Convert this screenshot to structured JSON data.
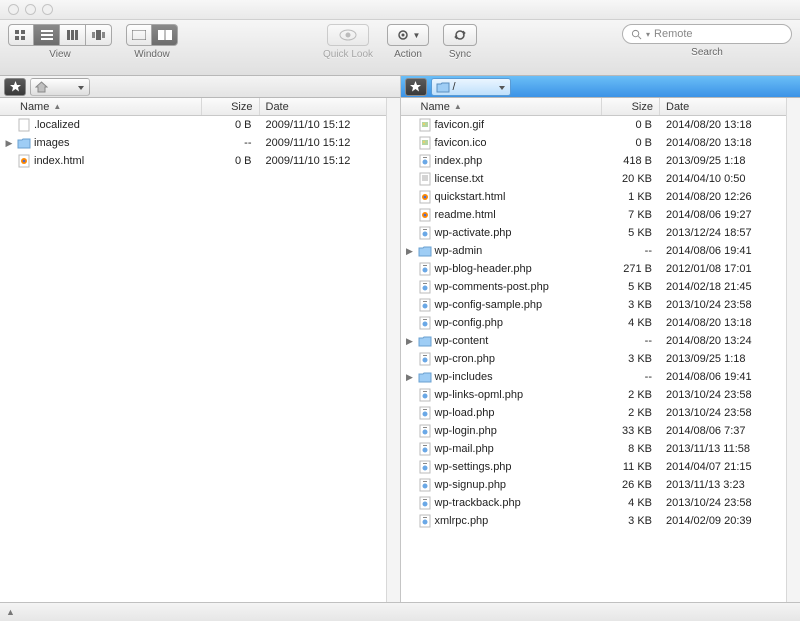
{
  "toolbar": {
    "view_label": "View",
    "window_label": "Window",
    "quicklook_label": "Quick Look",
    "action_label": "Action",
    "sync_label": "Sync",
    "search_label": "Search",
    "search_placeholder": "Remote"
  },
  "columns": {
    "name": "Name",
    "size": "Size",
    "date": "Date"
  },
  "left": {
    "path": "/",
    "files": [
      {
        "name": ".localized",
        "size": "0 B",
        "date": "2009/11/10 15:12",
        "type": "file"
      },
      {
        "name": "images",
        "size": "--",
        "date": "2009/11/10 15:12",
        "type": "folder",
        "expandable": true
      },
      {
        "name": "index.html",
        "size": "0 B",
        "date": "2009/11/10 15:12",
        "type": "html"
      }
    ]
  },
  "right": {
    "path": "/",
    "files": [
      {
        "name": "favicon.gif",
        "size": "0 B",
        "date": "2014/08/20 13:18",
        "type": "img"
      },
      {
        "name": "favicon.ico",
        "size": "0 B",
        "date": "2014/08/20 13:18",
        "type": "img"
      },
      {
        "name": "index.php",
        "size": "418 B",
        "date": "2013/09/25 1:18",
        "type": "php"
      },
      {
        "name": "license.txt",
        "size": "20 KB",
        "date": "2014/04/10 0:50",
        "type": "txt"
      },
      {
        "name": "quickstart.html",
        "size": "1 KB",
        "date": "2014/08/20 12:26",
        "type": "html"
      },
      {
        "name": "readme.html",
        "size": "7 KB",
        "date": "2014/08/06 19:27",
        "type": "html"
      },
      {
        "name": "wp-activate.php",
        "size": "5 KB",
        "date": "2013/12/24 18:57",
        "type": "php"
      },
      {
        "name": "wp-admin",
        "size": "--",
        "date": "2014/08/06 19:41",
        "type": "folder",
        "expandable": true
      },
      {
        "name": "wp-blog-header.php",
        "size": "271 B",
        "date": "2012/01/08 17:01",
        "type": "php"
      },
      {
        "name": "wp-comments-post.php",
        "size": "5 KB",
        "date": "2014/02/18 21:45",
        "type": "php"
      },
      {
        "name": "wp-config-sample.php",
        "size": "3 KB",
        "date": "2013/10/24 23:58",
        "type": "php"
      },
      {
        "name": "wp-config.php",
        "size": "4 KB",
        "date": "2014/08/20 13:18",
        "type": "php"
      },
      {
        "name": "wp-content",
        "size": "--",
        "date": "2014/08/20 13:24",
        "type": "folder",
        "expandable": true
      },
      {
        "name": "wp-cron.php",
        "size": "3 KB",
        "date": "2013/09/25 1:18",
        "type": "php"
      },
      {
        "name": "wp-includes",
        "size": "--",
        "date": "2014/08/06 19:41",
        "type": "folder",
        "expandable": true
      },
      {
        "name": "wp-links-opml.php",
        "size": "2 KB",
        "date": "2013/10/24 23:58",
        "type": "php"
      },
      {
        "name": "wp-load.php",
        "size": "2 KB",
        "date": "2013/10/24 23:58",
        "type": "php"
      },
      {
        "name": "wp-login.php",
        "size": "33 KB",
        "date": "2014/08/06 7:37",
        "type": "php"
      },
      {
        "name": "wp-mail.php",
        "size": "8 KB",
        "date": "2013/11/13 11:58",
        "type": "php"
      },
      {
        "name": "wp-settings.php",
        "size": "11 KB",
        "date": "2014/04/07 21:15",
        "type": "php"
      },
      {
        "name": "wp-signup.php",
        "size": "26 KB",
        "date": "2013/11/13 3:23",
        "type": "php"
      },
      {
        "name": "wp-trackback.php",
        "size": "4 KB",
        "date": "2013/10/24 23:58",
        "type": "php"
      },
      {
        "name": "xmlrpc.php",
        "size": "3 KB",
        "date": "2014/02/09 20:39",
        "type": "php"
      }
    ]
  }
}
